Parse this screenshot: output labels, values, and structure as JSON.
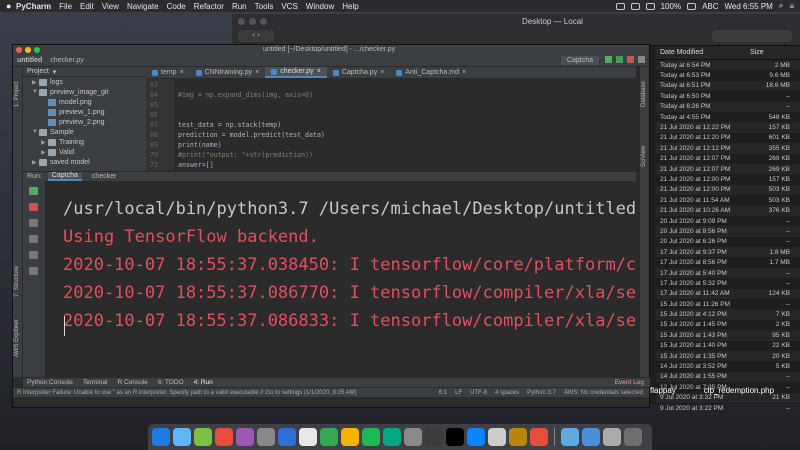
{
  "menubar": {
    "app": "PyCharm",
    "menus": [
      "File",
      "Edit",
      "View",
      "Navigate",
      "Code",
      "Refactor",
      "Run",
      "Tools",
      "VCS",
      "Window",
      "Help"
    ],
    "battery": "100%",
    "input": "ABC",
    "clock": "Wed 6:55 PM"
  },
  "finder": {
    "title": "Desktop — Local",
    "columns": {
      "date": "Date Modified",
      "size": "Size"
    },
    "rows": [
      {
        "date": "Today at 6:54 PM",
        "size": "2 MB"
      },
      {
        "date": "Today at 6:53 PM",
        "size": "9.6 MB"
      },
      {
        "date": "Today at 6:51 PM",
        "size": "18.6 MB"
      },
      {
        "date": "Today at 6:50 PM",
        "size": "--"
      },
      {
        "date": "Today at 6:26 PM",
        "size": "--"
      },
      {
        "date": "Today at 4:55 PM",
        "size": "548 KB"
      },
      {
        "date": "21 Jul 2020 at 12:22 PM",
        "size": "157 KB"
      },
      {
        "date": "21 Jul 2020 at 12:20 PM",
        "size": "601 KB"
      },
      {
        "date": "21 Jul 2020 at 12:12 PM",
        "size": "355 KB"
      },
      {
        "date": "21 Jul 2020 at 12:07 PM",
        "size": "269 KB"
      },
      {
        "date": "21 Jul 2020 at 12:07 PM",
        "size": "269 KB"
      },
      {
        "date": "21 Jul 2020 at 12:00 PM",
        "size": "157 KB"
      },
      {
        "date": "21 Jul 2020 at 12:00 PM",
        "size": "503 KB"
      },
      {
        "date": "21 Jul 2020 at 11:54 AM",
        "size": "503 KB"
      },
      {
        "date": "21 Jul 2020 at 10:26 AM",
        "size": "376 KB"
      },
      {
        "date": "20 Jul 2020 at 9:09 PM",
        "size": "--"
      },
      {
        "date": "20 Jul 2020 at 8:56 PM",
        "size": "--"
      },
      {
        "date": "20 Jul 2020 at 6:26 PM",
        "size": "--"
      },
      {
        "date": "17 Jul 2020 at 9:37 PM",
        "size": "1.8 MB"
      },
      {
        "date": "17 Jul 2020 at 8:56 PM",
        "size": "1.7 MB"
      },
      {
        "date": "17 Jul 2020 at 5:40 PM",
        "size": "--"
      },
      {
        "date": "17 Jul 2020 at 5:32 PM",
        "size": "--"
      },
      {
        "date": "17 Jul 2020 at 11:42 AM",
        "size": "124 KB"
      },
      {
        "date": "15 Jul 2020 at 11:26 PM",
        "size": "--"
      },
      {
        "date": "15 Jul 2020 at 4:12 PM",
        "size": "7 KB"
      },
      {
        "date": "15 Jul 2020 at 1:45 PM",
        "size": "2 KB"
      },
      {
        "date": "15 Jul 2020 at 1:43 PM",
        "size": "95 KB"
      },
      {
        "date": "15 Jul 2020 at 1:40 PM",
        "size": "22 KB"
      },
      {
        "date": "15 Jul 2020 at 1:35 PM",
        "size": "20 KB"
      },
      {
        "date": "14 Jul 2020 at 3:52 PM",
        "size": "5 KB"
      },
      {
        "date": "14 Jul 2020 at 1:55 PM",
        "size": "--"
      },
      {
        "date": "12 Jul 2020 at 7:35 PM",
        "size": "--"
      },
      {
        "date": "9 Jul 2020 at 3:32 PM",
        "size": "21 KB"
      },
      {
        "date": "9 Jul 2020 at 3:22 PM",
        "size": "--"
      }
    ],
    "files": [
      "flappay",
      "clp_redemption.php",
      "flappay"
    ]
  },
  "pycharm": {
    "window_title": "untitled [~/Desktop/untitled] - .../checker.py",
    "breadcrumb": [
      "untitled",
      "checker.py"
    ],
    "run_config": "Captcha",
    "project_label": "Project",
    "tree": [
      {
        "label": "logs",
        "kind": "folder",
        "depth": 1,
        "arrow": "▶"
      },
      {
        "label": "preview_image_git",
        "kind": "folder",
        "depth": 1,
        "arrow": "▼"
      },
      {
        "label": "model.png",
        "kind": "png",
        "depth": 2,
        "arrow": ""
      },
      {
        "label": "preview_1.png",
        "kind": "png",
        "depth": 2,
        "arrow": ""
      },
      {
        "label": "preview_2.png",
        "kind": "png",
        "depth": 2,
        "arrow": ""
      },
      {
        "label": "Sample",
        "kind": "folder",
        "depth": 1,
        "arrow": "▼"
      },
      {
        "label": "Training",
        "kind": "folder",
        "depth": 2,
        "arrow": "▶"
      },
      {
        "label": "Valid",
        "kind": "folder",
        "depth": 2,
        "arrow": "▶"
      },
      {
        "label": "saved model",
        "kind": "folder",
        "depth": 1,
        "arrow": "▶"
      }
    ],
    "tabs": [
      "temp",
      "CNNtraining.py",
      "checker.py",
      "Captcha.py",
      "Anti_Captcha.md"
    ],
    "active_tab": 2,
    "code_lines": [
      {
        "ln": "63",
        "text": "",
        "cls": "c-norm"
      },
      {
        "ln": "64",
        "text": "#img = np.expand_dims(img, axis=0)",
        "cls": "c-com"
      },
      {
        "ln": "65",
        "text": "",
        "cls": "c-norm"
      },
      {
        "ln": "66",
        "text": "",
        "cls": "c-norm"
      },
      {
        "ln": "67",
        "text": "test_data = np.stack(temp)",
        "cls": "c-norm"
      },
      {
        "ln": "68",
        "text": "prediction = model.predict(test_data)",
        "cls": "c-norm"
      },
      {
        "ln": "69",
        "text": "print(name)",
        "cls": "c-norm"
      },
      {
        "ln": "70",
        "text": "#print(\"output: \"+str(prediction))",
        "cls": "c-com"
      },
      {
        "ln": "71",
        "text": "answer=[]",
        "cls": "c-norm"
      }
    ],
    "run_label": "Run:",
    "run_tabs": [
      "Captcha",
      "checker"
    ],
    "console_lines": [
      {
        "text": "/usr/local/bin/python3.7 /Users/michael/Desktop/untitled/checker.py",
        "color": "#c8c8c8"
      },
      {
        "text": "Using TensorFlow backend.",
        "color": "#e0505f"
      },
      {
        "text": "2020-10-07 18:55:37.038450: I tensorflow/core/platform/cpu_feature_guard.cc",
        "color": "#e0505f"
      },
      {
        "text": "2020-10-07 18:55:37.086770: I tensorflow/compiler/xla/service/service.cc",
        "color": "#e0505f"
      },
      {
        "text": "2020-10-07 18:55:37.086833: I tensorflow/compiler/xla/service/service.cc",
        "color": "#e0505f"
      }
    ],
    "bottom_tabs": [
      "Python Console",
      "Terminal",
      "R Console",
      "6: TODO",
      "4: Run"
    ],
    "event_log": "Event Log",
    "status_message": "R Interpreter Failure: Unable to use \" as an R interpreter. Specify path to a valid executable // Go to settings (1/1/2020, 8:05 AM)",
    "status_right": [
      "6:1",
      "LF",
      "UTF-8",
      "4 spaces",
      "Python 3.7",
      "AWS: No credentials selected"
    ],
    "side_labels": {
      "left_top": "1: Project",
      "left_mid": "7: Structure",
      "left_aws": "AWS Explorer",
      "left_fav": "2: Favorites",
      "right_db": "Database",
      "right_sciview": "SciView"
    }
  },
  "dock": [
    "#1d7ae3",
    "#5fb7f6",
    "#7bc043",
    "#e94b3c",
    "#9b59b6",
    "#888888",
    "#2f6fd3",
    "#e8e8e8",
    "#34a853",
    "#f4b400",
    "#1db954",
    "#00a884",
    "#8a8a8a",
    "#3c3c3c",
    "#000000",
    "#0a84ff",
    "#cccccc",
    "#b8860b",
    "#e74c3c",
    "#5fa8e0",
    "#4c8ed9",
    "#aaaaaa",
    "#6e6e6e"
  ]
}
